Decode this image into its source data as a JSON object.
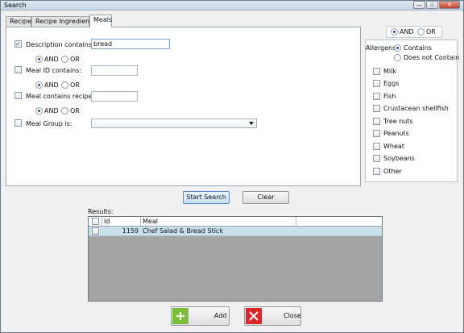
{
  "window": {
    "title": "Search",
    "min_glyph": "—",
    "max_glyph": "▫",
    "close_glyph": "✕"
  },
  "tabs": [
    "Recipe",
    "Recipe Ingredient",
    "Meals"
  ],
  "fields": {
    "description": {
      "label": "Description contains:",
      "checked": true,
      "value": "bread"
    },
    "meal_id": {
      "label": "Meal ID contains:",
      "checked": false,
      "value": ""
    },
    "recipe_id": {
      "label": "Meal contains recipe ID:",
      "checked": false,
      "value": ""
    },
    "meal_group": {
      "label": "Meal Group is:",
      "checked": false,
      "value": ""
    }
  },
  "logic": {
    "and": "AND",
    "or": "OR"
  },
  "allergens": {
    "label": "Allergens",
    "contains": "Contains",
    "not_contains": "Does not Contain",
    "items": [
      "Milk",
      "Eggs",
      "Fish",
      "Crustacean shellfish",
      "Tree nuts",
      "Peanuts",
      "Wheat",
      "Soybeans",
      "Other"
    ]
  },
  "buttons": {
    "start_search": "Start Search",
    "clear": "Clear",
    "add": "Add",
    "close": "Close"
  },
  "results": {
    "label": "Results:",
    "columns": [
      "Id",
      "Meal"
    ],
    "rows": [
      {
        "id": "1159",
        "meal": "Chef Salad & Bread Stick"
      }
    ]
  },
  "colors": {
    "add_icon": "#7bbf3a",
    "close_icon": "#d9262b",
    "selected_row": "#c9e1ea",
    "grid_empty": "#a4a4a4"
  }
}
